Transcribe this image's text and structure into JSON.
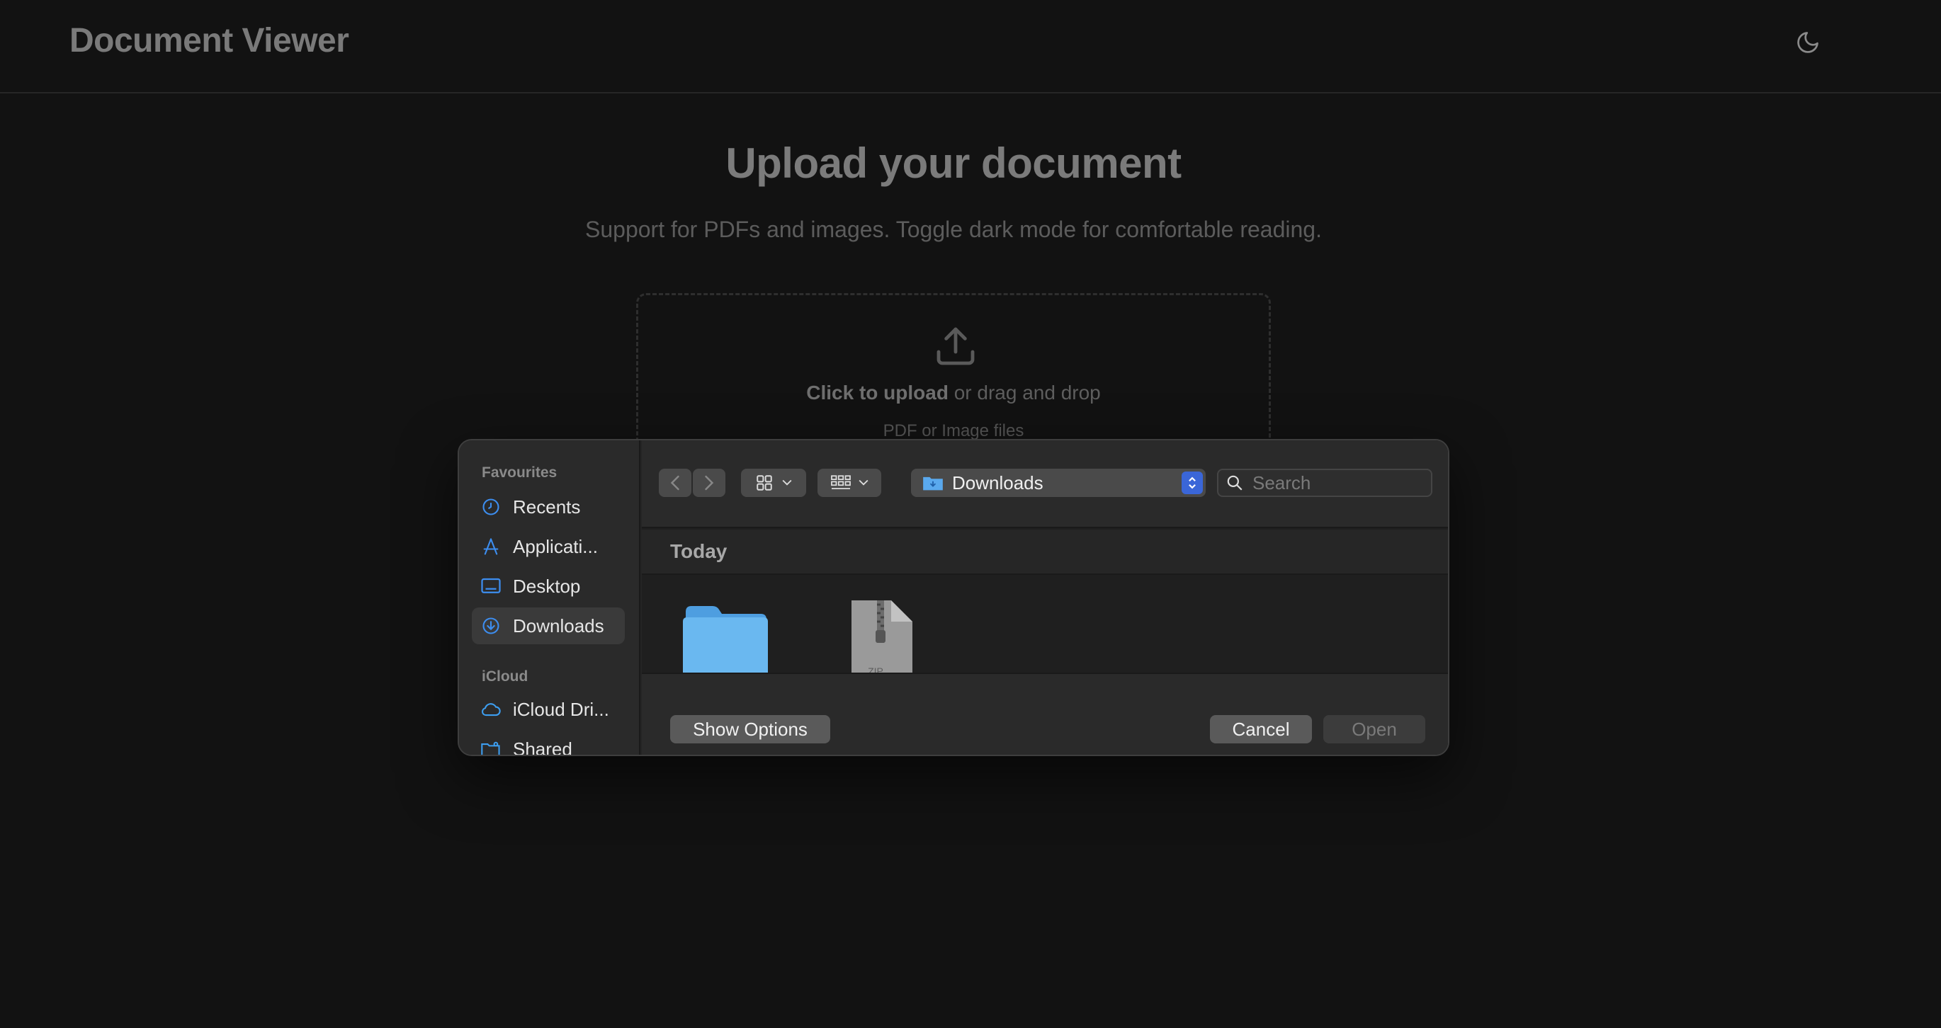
{
  "app": {
    "title": "Document Viewer",
    "theme_toggle_icon": "moon-icon"
  },
  "main": {
    "heading": "Upload your document",
    "subtitle": "Support for PDFs and images. Toggle dark mode for comfortable reading.",
    "dropzone": {
      "cta_bold": "Click to upload",
      "cta_rest": " or drag and drop",
      "hint": "PDF or Image files"
    }
  },
  "dialog": {
    "sidebar": {
      "favourites_label": "Favourites",
      "favourites": [
        {
          "label": "Recents",
          "icon": "clock-icon"
        },
        {
          "label": "Applicati...",
          "icon": "applications-icon"
        },
        {
          "label": "Desktop",
          "icon": "desktop-icon"
        },
        {
          "label": "Downloads",
          "icon": "downloads-icon",
          "selected": true
        }
      ],
      "icloud_label": "iCloud",
      "icloud": [
        {
          "label": "iCloud Dri...",
          "icon": "cloud-icon"
        },
        {
          "label": "Shared",
          "icon": "shared-folder-icon"
        }
      ]
    },
    "toolbar": {
      "location": "Downloads",
      "search_placeholder": "Search"
    },
    "group_header": "Today",
    "files": [
      {
        "kind": "folder",
        "icon": "folder-icon"
      },
      {
        "kind": "zip",
        "icon": "zip-file-icon",
        "badge": "ZIP"
      }
    ],
    "footer": {
      "show_options": "Show Options",
      "cancel": "Cancel",
      "open": "Open"
    }
  },
  "colors": {
    "background": "#121212",
    "accent": "#3a66d8",
    "folder": "#6ab8f0"
  }
}
